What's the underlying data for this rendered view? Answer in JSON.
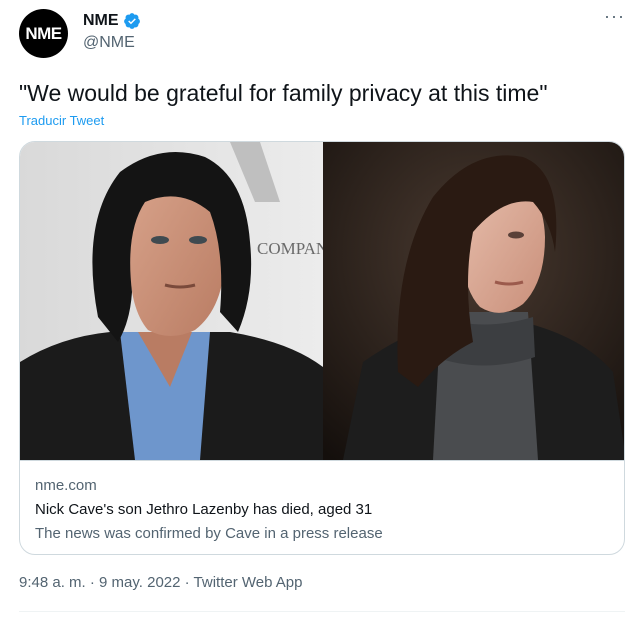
{
  "tweet": {
    "avatar_text": "NME",
    "display_name": "NME",
    "handle": "@NME",
    "more_label": "···",
    "text": "\"We would be grateful for family privacy at this time\"",
    "translate_label": "Traducir Tweet",
    "timestamp": "9:48 a. m. · 9 may. 2022 · Twitter Web App"
  },
  "card": {
    "left_sign_text": "COMPAN",
    "domain": "nme.com",
    "title": "Nick Cave's son Jethro Lazenby has died, aged 31",
    "description": "The news was confirmed by Cave in a press release"
  },
  "colors": {
    "accent": "#1d9bf0",
    "secondary_text": "#536471",
    "border": "#cfd9de"
  }
}
